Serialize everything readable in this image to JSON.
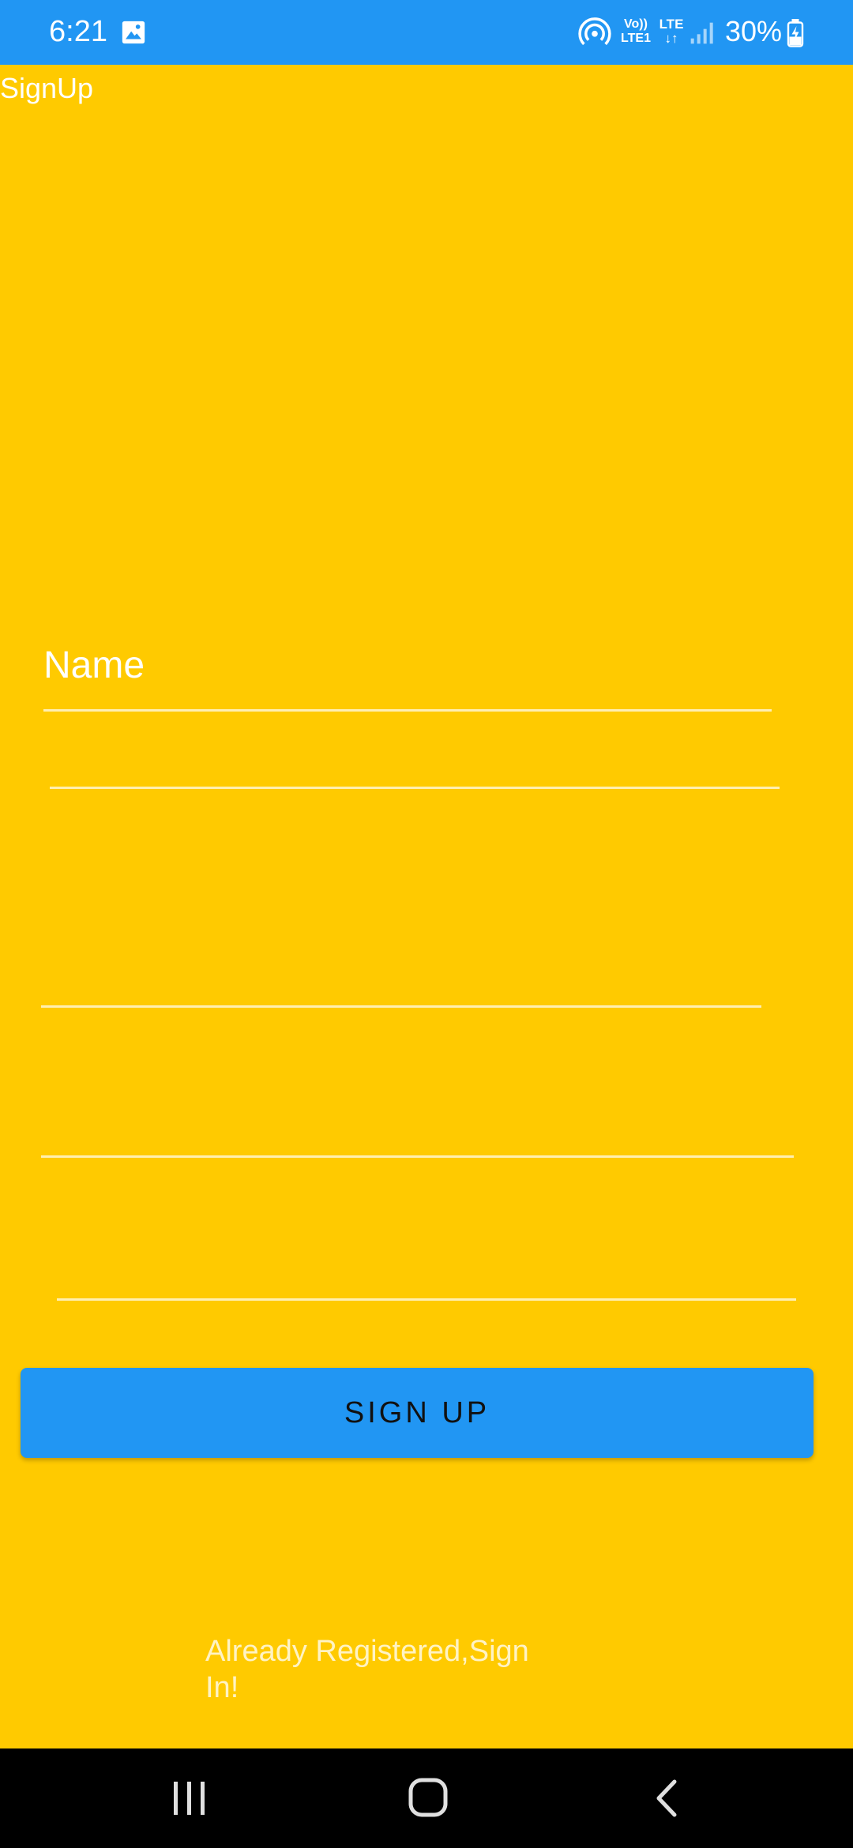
{
  "status_bar": {
    "time": "6:21",
    "volte_line1": "Vo))",
    "volte_line2": "LTE1",
    "lte_line1": "LTE",
    "lte_line2": "↓↑",
    "battery": "30%",
    "icons": [
      "gallery-icon",
      "hotspot-icon",
      "volte-icon",
      "lte-icon",
      "signal-icon",
      "battery-icon"
    ]
  },
  "app": {
    "title": "SignUp"
  },
  "form": {
    "name_placeholder": "Name",
    "field2_value": "",
    "field3_value": "",
    "field4_value": "",
    "field5_value": "",
    "signup_label": "SIGN UP",
    "signin_link": "Already Registered,Sign In!"
  },
  "nav_bar": {
    "icons": [
      "recent-apps-icon",
      "home-icon",
      "back-icon"
    ]
  },
  "colors": {
    "background": "#FFCA00",
    "accent": "#2196F3",
    "text_light": "#FFFFFF",
    "nav_bar": "#000000"
  }
}
